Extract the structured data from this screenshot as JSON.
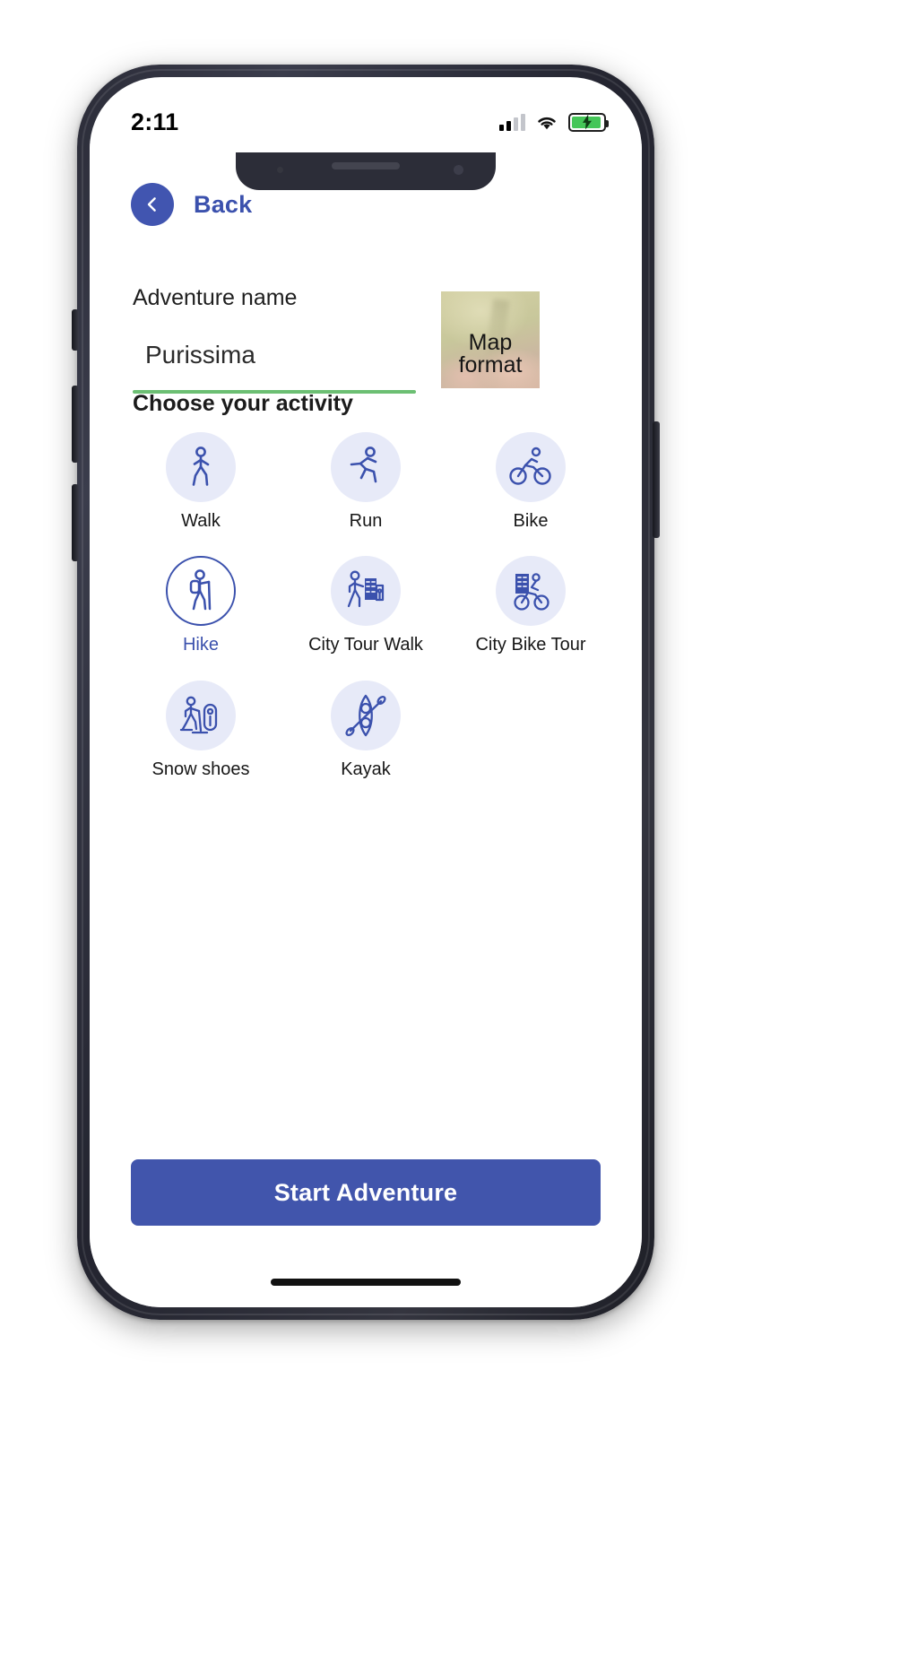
{
  "status_bar": {
    "time": "2:11",
    "signal_icon": "cellular-signal-icon",
    "wifi_icon": "wifi-icon",
    "battery_icon": "battery-charging-icon",
    "battery_color": "#45c658"
  },
  "nav": {
    "back_icon": "chevron-left-icon",
    "back_label": "Back",
    "accent_color": "#3b51ad"
  },
  "form": {
    "name_label": "Adventure name",
    "name_value": "Purissima",
    "name_placeholder": "Adventure name",
    "underline_color": "#6cbf73"
  },
  "map_format": {
    "label": "Map format",
    "thumbnail_name": "map-format-thumbnail"
  },
  "activity": {
    "section_title": "Choose your activity",
    "selected": "Hike",
    "items": [
      {
        "label": "Walk",
        "icon": "walking-person-icon",
        "selected": false
      },
      {
        "label": "Run",
        "icon": "running-person-icon",
        "selected": false
      },
      {
        "label": "Bike",
        "icon": "bicycle-icon",
        "selected": false
      },
      {
        "label": "Hike",
        "icon": "hiking-person-icon",
        "selected": true
      },
      {
        "label": "City Tour Walk",
        "icon": "city-walk-icon",
        "selected": false
      },
      {
        "label": "City Bike Tour",
        "icon": "city-bike-icon",
        "selected": false
      },
      {
        "label": "Snow shoes",
        "icon": "snowshoe-icon",
        "selected": false
      },
      {
        "label": "Kayak",
        "icon": "kayak-icon",
        "selected": false
      }
    ]
  },
  "footer": {
    "start_label": "Start Adventure",
    "start_color": "#4155ac",
    "home_indicator": "home-indicator"
  }
}
